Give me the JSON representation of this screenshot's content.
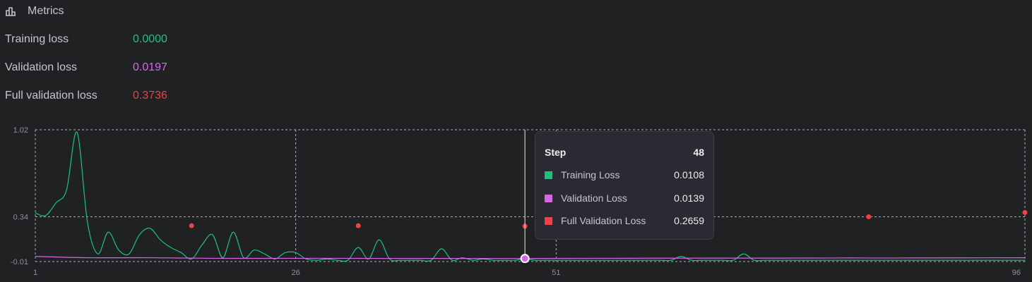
{
  "header": {
    "title": "Metrics",
    "icon": "bar-chart-icon"
  },
  "metrics": [
    {
      "label": "Training loss",
      "value": "0.0000",
      "color": "#19c37d"
    },
    {
      "label": "Validation loss",
      "value": "0.0197",
      "color": "#d865e8"
    },
    {
      "label": "Full validation loss",
      "value": "0.3736",
      "color": "#ef4146"
    }
  ],
  "tooltip": {
    "step_label": "Step",
    "step_value": "48",
    "rows": [
      {
        "label": "Training Loss",
        "value": "0.0108",
        "color": "#19c37d"
      },
      {
        "label": "Validation Loss",
        "value": "0.0139",
        "color": "#d865e8"
      },
      {
        "label": "Full Validation Loss",
        "value": "0.2659",
        "color": "#ef4146"
      }
    ]
  },
  "chart_data": {
    "type": "line",
    "x_ticks": [
      1,
      26,
      51,
      96
    ],
    "y_ticks": [
      1.02,
      0.34,
      -0.01
    ],
    "y_tick_labels": [
      "1.02",
      "0.34",
      "-0.01"
    ],
    "xlim": [
      1,
      96
    ],
    "ylim": [
      -0.01,
      1.02
    ],
    "grid": true,
    "hover_step": 48,
    "series": [
      {
        "name": "Training Loss",
        "color": "#19c37d",
        "kind": "line",
        "x": [
          1,
          2,
          3,
          4,
          5,
          6,
          7,
          8,
          9,
          10,
          11,
          12,
          13,
          14,
          15,
          16,
          17,
          18,
          19,
          20,
          21,
          22,
          23,
          24,
          25,
          26,
          27,
          28,
          29,
          30,
          31,
          32,
          33,
          34,
          35,
          36,
          37,
          38,
          39,
          40,
          41,
          42,
          43,
          44,
          45,
          46,
          47,
          48,
          49,
          50,
          51,
          52,
          53,
          54,
          55,
          56,
          57,
          58,
          59,
          60,
          61,
          62,
          63,
          64,
          65,
          66,
          67,
          68,
          69,
          70,
          71,
          72,
          73,
          74,
          75,
          76,
          77,
          78,
          79,
          80,
          81,
          82,
          83,
          84,
          85,
          86,
          87,
          88,
          89,
          90,
          91,
          92,
          93,
          94,
          95,
          96
        ],
        "y": [
          0.37,
          0.35,
          0.45,
          0.55,
          1.0,
          0.3,
          0.05,
          0.22,
          0.08,
          0.05,
          0.2,
          0.25,
          0.16,
          0.1,
          0.06,
          0.01,
          0.12,
          0.2,
          0.02,
          0.22,
          0.02,
          0.08,
          0.05,
          0.01,
          0.06,
          0.06,
          0.01,
          0.0,
          0.01,
          0.0,
          0.0,
          0.1,
          0.01,
          0.16,
          0.01,
          0.0,
          0.0,
          0.0,
          0.0,
          0.09,
          0.0,
          0.02,
          0.0,
          0.01,
          0.0,
          0.0,
          0.0,
          0.0108,
          0.0,
          0.0,
          0.0,
          0.0,
          0.0,
          0.0,
          0.0,
          0.0,
          0.0,
          0.0,
          0.0,
          0.0,
          0.0,
          0.0,
          0.03,
          0.0,
          0.0,
          0.0,
          0.0,
          0.0,
          0.05,
          0.0,
          0.0,
          0.0,
          0.0,
          0.0,
          0.0,
          0.0,
          0.0,
          0.0,
          0.0,
          0.0,
          0.0,
          0.0,
          0.0,
          0.0,
          0.0,
          0.0,
          0.0,
          0.0,
          0.0,
          0.0,
          0.0,
          0.0,
          0.0,
          0.0,
          0.0,
          0.0
        ]
      },
      {
        "name": "Validation Loss",
        "color": "#d865e8",
        "kind": "line",
        "x": [
          1,
          6,
          12,
          18,
          24,
          30,
          36,
          42,
          48,
          54,
          60,
          66,
          72,
          78,
          84,
          90,
          96
        ],
        "y": [
          0.03,
          0.02,
          0.02,
          0.015,
          0.015,
          0.015,
          0.014,
          0.014,
          0.0139,
          0.015,
          0.016,
          0.017,
          0.017,
          0.018,
          0.018,
          0.019,
          0.0197
        ]
      },
      {
        "name": "Full Validation Loss",
        "color": "#ef4146",
        "kind": "scatter",
        "x": [
          16,
          32,
          48,
          81,
          96
        ],
        "y": [
          0.27,
          0.27,
          0.2659,
          0.34,
          0.3736
        ]
      }
    ]
  }
}
